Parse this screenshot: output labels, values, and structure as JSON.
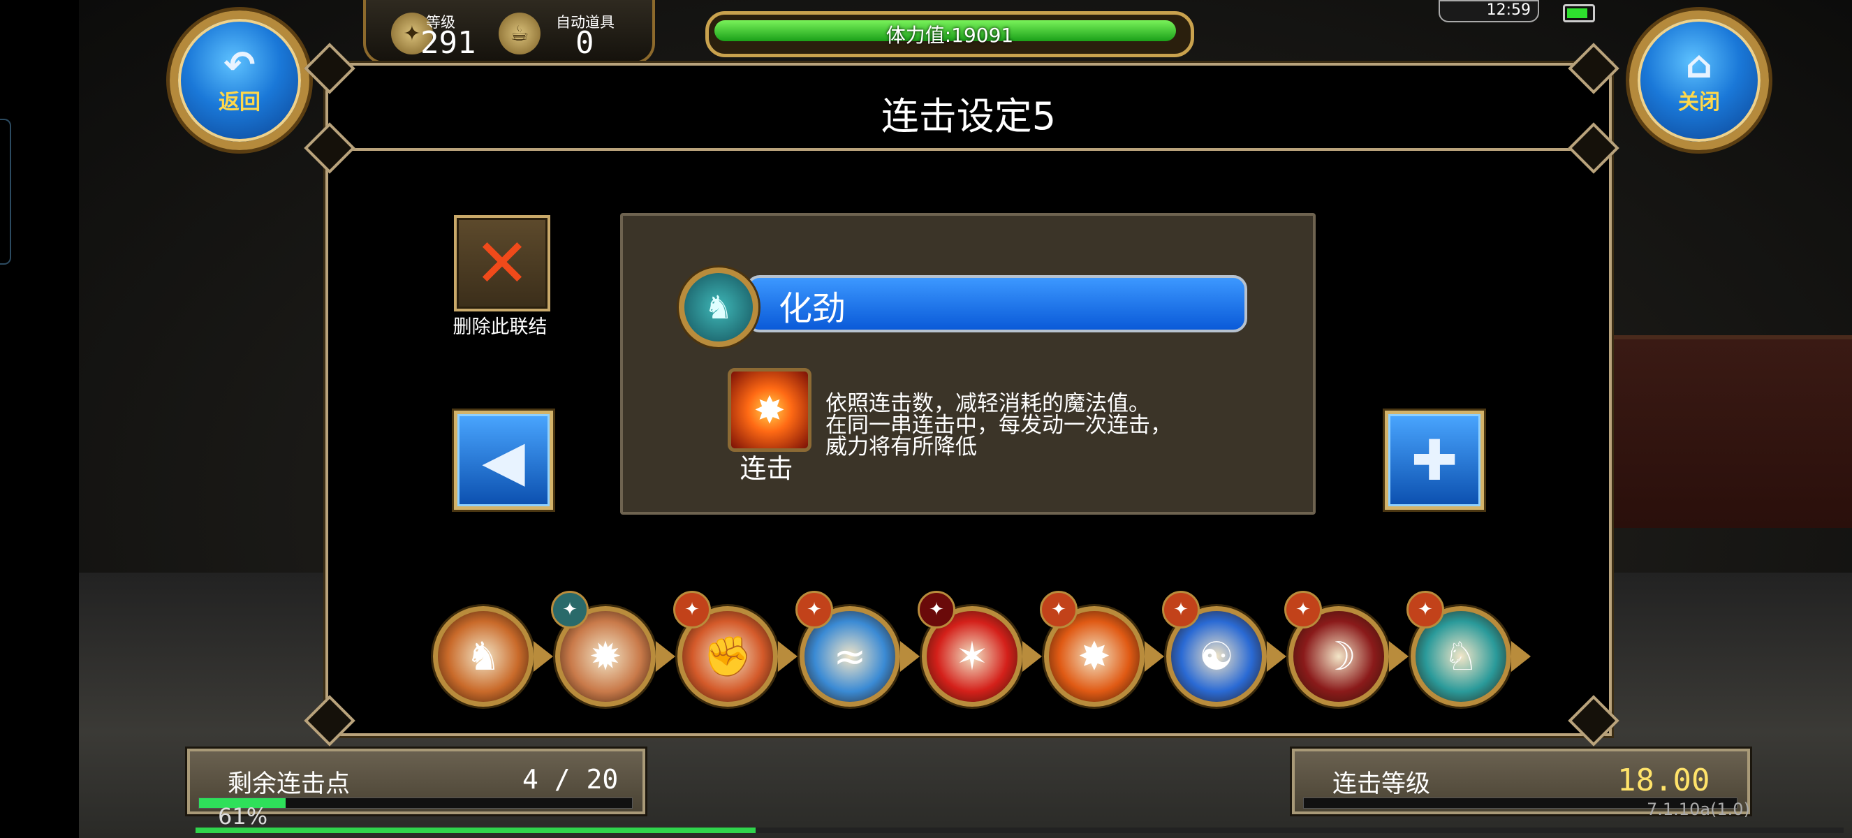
{
  "hud": {
    "back_label": "返回",
    "close_label": "关闭",
    "level_label": "等级",
    "level_value": "291",
    "auto_item_label": "自动道具",
    "auto_item_value": "0",
    "stamina_text": "体力值:19091",
    "stamina_fraction": 0.98,
    "clock": "12:59",
    "battery_fraction": 0.85
  },
  "panel": {
    "title": "连击设定5",
    "delete_label": "删除此联结",
    "skill_name": "化劲",
    "combo_label": "连击",
    "description": [
      "依照连击数，减轻消耗的魔法值。",
      "在同一串连击中，每发动一次连击，",
      "威力将有所降低"
    ]
  },
  "chain": {
    "items": [
      {
        "icon": "warrior-figure-icon",
        "color": "#c96a2a"
      },
      {
        "icon": "ground-burst-icon",
        "color": "#c97a4a"
      },
      {
        "icon": "strike-figure-icon",
        "color": "#d45a2a"
      },
      {
        "icon": "ice-wave-icon",
        "color": "#3a8ad4"
      },
      {
        "icon": "red-burst-icon",
        "color": "#d4201a"
      },
      {
        "icon": "fire-burst-icon",
        "color": "#e05a14"
      },
      {
        "icon": "meditate-icon",
        "color": "#2a6ad4"
      },
      {
        "icon": "crimson-slash-icon",
        "color": "#8a1a1a"
      },
      {
        "icon": "wind-figure-icon",
        "color": "#2a9a9a"
      }
    ]
  },
  "bottom": {
    "points_label": "剩余连击点",
    "points_value": "4 / 20",
    "points_fraction": 0.2,
    "rank_label": "连击等级",
    "rank_value": "18.00",
    "exp_text": "61%",
    "exp_fraction": 0.34,
    "version_text": "7.1.10a(1.0)"
  }
}
